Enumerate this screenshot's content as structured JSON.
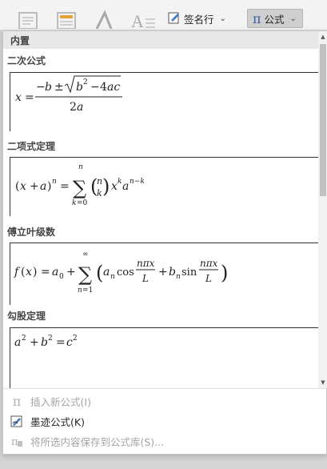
{
  "ribbon": {
    "signature_button": "签名行",
    "equation_button": "公式"
  },
  "gallery": {
    "section_header": "内置",
    "equations": [
      {
        "title": "二次公式",
        "name": "quadratic-formula"
      },
      {
        "title": "二项式定理",
        "name": "binomial-theorem"
      },
      {
        "title": "傅立叶级数",
        "name": "fourier-series"
      },
      {
        "title": "勾股定理",
        "name": "pythagorean-theorem"
      }
    ]
  },
  "menu": {
    "insert_new": "插入新公式(I)",
    "ink_equation": "墨迹公式(K)",
    "save_selection": "将所选内容保存到公式库(S)..."
  },
  "colors": {
    "section_header_bg": "#e8e8e8",
    "pressed_button_bg": "#cfcfcf",
    "disabled_text": "#a4a4a4"
  }
}
